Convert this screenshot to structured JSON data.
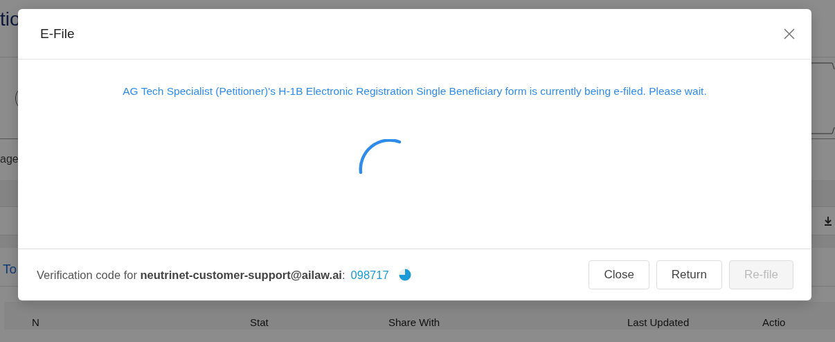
{
  "background": {
    "title": "tio",
    "label": "age",
    "link": "To",
    "table_columns": [
      "N",
      "Stat",
      "Share With",
      "Last Updated",
      "Actio"
    ]
  },
  "dialog": {
    "title": "E-File",
    "message": "AG Tech Specialist (Petitioner)'s H-1B Electronic Registration Single Beneficiary form is currently being e-filed. Please wait.",
    "verification": {
      "prefix": "Verification code for ",
      "email": "neutrinet-customer-support@ailaw.ai",
      "separator": ":",
      "code": "098717"
    },
    "buttons": [
      {
        "label": "Close",
        "disabled": false
      },
      {
        "label": "Return",
        "disabled": false
      },
      {
        "label": "Re-file",
        "disabled": true
      }
    ]
  }
}
